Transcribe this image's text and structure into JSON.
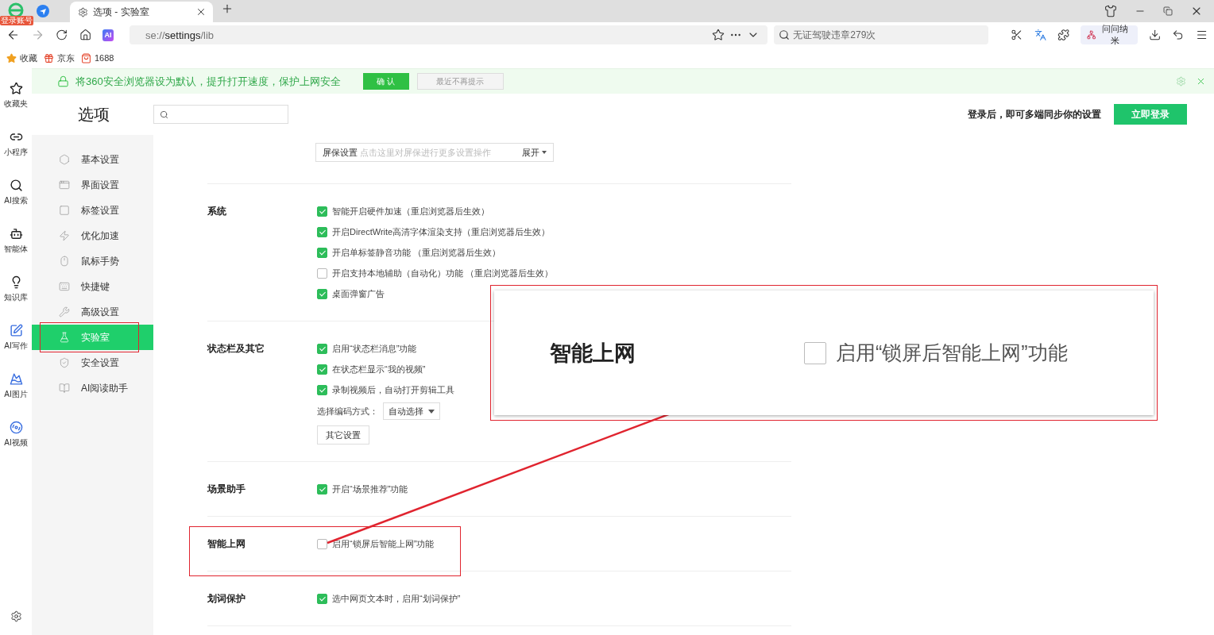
{
  "window": {
    "login_badge": "登录账号",
    "tabs": [
      {
        "label": "选项 - 实验室",
        "selected": true
      }
    ]
  },
  "address_bar": {
    "ai_badge": "AI",
    "url": "se://**settings**/lib"
  },
  "search": {
    "placeholder": "无证驾驶违章279次"
  },
  "toolbar": {
    "profile": "问问纳米"
  },
  "bookmarks": [
    {
      "label": "收藏"
    },
    {
      "label": "京东"
    },
    {
      "label": "1688"
    }
  ],
  "banner": {
    "message": "将360安全浏览器设为默认，提升打开速度，保护上网安全",
    "confirm": "确 认",
    "dismiss": "最近不再提示"
  },
  "rail": [
    {
      "label": "收藏夹"
    },
    {
      "label": "小程序"
    },
    {
      "label": "AI搜索"
    },
    {
      "label": "智能体"
    },
    {
      "label": "知识库"
    },
    {
      "label": "AI写作"
    },
    {
      "label": "AI图片"
    },
    {
      "label": "AI视频"
    }
  ],
  "page": {
    "title": "选项",
    "sync_hint": "登录后，即可多端同步你的设置",
    "login_button": "立即登录"
  },
  "nav": [
    {
      "label": "基本设置",
      "selected": false
    },
    {
      "label": "界面设置",
      "selected": false
    },
    {
      "label": "标签设置",
      "selected": false
    },
    {
      "label": "优化加速",
      "selected": false
    },
    {
      "label": "鼠标手势",
      "selected": false
    },
    {
      "label": "快捷键",
      "selected": false
    },
    {
      "label": "高级设置",
      "selected": false
    },
    {
      "label": "实验室",
      "selected": true
    },
    {
      "label": "安全设置",
      "selected": false
    },
    {
      "label": "AI阅读助手",
      "selected": false
    }
  ],
  "screensaver": {
    "label": "屏保设置",
    "hint": "点击这里对屏保进行更多设置操作",
    "toggle": "展开"
  },
  "sections": [
    {
      "title": "系统",
      "items": [
        {
          "kind": "checkbox",
          "label": "智能开启硬件加速（重启浏览器后生效）",
          "checked": true
        },
        {
          "kind": "checkbox",
          "label": "开启DirectWrite高清字体渲染支持（重启浏览器后生效）",
          "checked": true
        },
        {
          "kind": "checkbox",
          "label": "开启单标签静音功能 （重启浏览器后生效）",
          "checked": true
        },
        {
          "kind": "checkbox",
          "label": "开启支持本地辅助（自动化）功能 （重启浏览器后生效）",
          "checked": false
        },
        {
          "kind": "checkbox",
          "label": "桌面弹窗广告",
          "checked": true
        }
      ]
    },
    {
      "title": "状态栏及其它",
      "items": [
        {
          "kind": "checkbox",
          "label": "启用“状态栏消息”功能",
          "checked": true
        },
        {
          "kind": "checkbox",
          "label": "在状态栏显示“我的视频”",
          "checked": true
        },
        {
          "kind": "checkbox",
          "label": "录制视频后，自动打开剪辑工具",
          "checked": true
        },
        {
          "kind": "select",
          "label": "选择编码方式：",
          "value": "自动选择"
        },
        {
          "kind": "button",
          "label": "其它设置"
        }
      ]
    },
    {
      "title": "场景助手",
      "items": [
        {
          "kind": "checkbox",
          "label": "开启“场景推荐”功能",
          "checked": true
        }
      ]
    },
    {
      "title": "智能上网",
      "highlighted": true,
      "items": [
        {
          "kind": "checkbox",
          "label": "启用“锁屏后智能上网”功能",
          "checked": false
        }
      ]
    },
    {
      "title": "划词保护",
      "items": [
        {
          "kind": "checkbox",
          "label": "选中网页文本时，启用“划词保护”",
          "checked": true
        }
      ]
    }
  ],
  "callout": {
    "title": "智能上网",
    "option": {
      "label": "启用“锁屏后智能上网”功能",
      "checked": false
    }
  }
}
